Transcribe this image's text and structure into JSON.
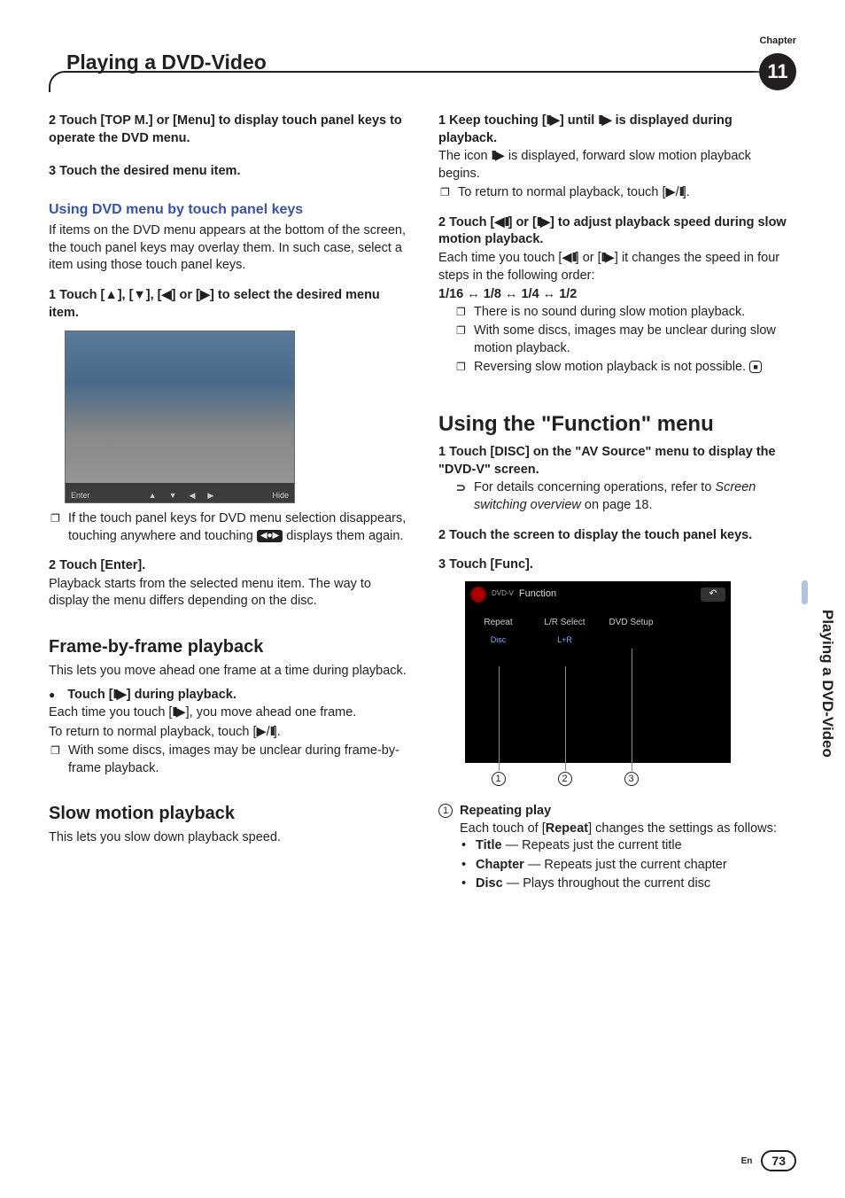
{
  "chapter_label": "Chapter",
  "chapter_number": "11",
  "page_title": "Playing a DVD-Video",
  "side_tab": "Playing a DVD-Video",
  "left": {
    "step2": "2    Touch [TOP M.] or [Menu] to display touch panel keys to operate the DVD menu.",
    "step3": "3    Touch the desired menu item.",
    "sub1_title": "Using DVD menu by touch panel keys",
    "sub1_body": "If items on the DVD menu appears at the bottom of the screen, the touch panel keys may overlay them. In such case, select a item using those touch panel keys.",
    "sub1_step1": "1    Touch [▲], [▼], [◀] or [▶] to select the desired menu item.",
    "img_enter": "Enter",
    "img_hide": "Hide",
    "sub1_note": "If the touch panel keys for DVD menu selection disappears, touching anywhere and touching ",
    "sub1_note_end": " displays them again.",
    "sub1_step2": "2    Touch [Enter].",
    "sub1_step2_body": "Playback starts from the selected menu item. The way to display the menu differs depending on the disc.",
    "sec2_title": "Frame-by-frame playback",
    "sec2_body": "This lets you move ahead one frame at a time during playback.",
    "sec2_bullet": "Touch [",
    "sec2_bullet_end": "] during playback.",
    "sec2_body2a": "Each time you touch [",
    "sec2_body2b": "], you move ahead one frame.",
    "sec2_body3": "To return to normal playback, touch [▶/",
    "sec2_body3_end": "].",
    "sec2_note": "With some discs, images may be unclear during frame-by-frame playback.",
    "sec3_title": "Slow motion playback",
    "sec3_body": "This lets you slow down playback speed."
  },
  "right": {
    "step1a": "1    Keep touching [",
    "step1b": "] until ",
    "step1c": " is displayed during playback.",
    "body1a": "The icon ",
    "body1b": " is displayed, forward slow motion playback begins.",
    "note1a": "To return to normal playback, touch [▶/",
    "note1b": "].",
    "step2a": "2    Touch [◀",
    "step2b": "] or [",
    "step2c": "▶] to adjust playback speed during slow motion playback.",
    "body2a": "Each time you touch [◀",
    "body2b": "] or [",
    "body2c": "▶] it changes the speed in four steps in the following order:",
    "speed": "1/16 ↔ 1/8 ↔ 1/4 ↔ 1/2",
    "note2_1": "There is no sound during slow motion playback.",
    "note2_2": "With some discs, images may be unclear during slow motion playback.",
    "note2_3a": "Reversing slow motion playback is not possible.",
    "sec_title": "Using the \"Function\" menu",
    "sec_step1": "1    Touch [DISC] on the \"AV Source\" menu to display the \"DVD-V\" screen.",
    "sec_note1": "For details concerning operations, refer to ",
    "sec_note1_ital": "Screen switching overview",
    "sec_note1_end": " on page 18.",
    "sec_step2": "2    Touch the screen to display the touch panel keys.",
    "sec_step3": "3    Touch [Func].",
    "func_label": "Function",
    "func_dvdv": "DVD-V",
    "func_repeat": "Repeat",
    "func_lr": "L/R Select",
    "func_dvd_setup": "DVD Setup",
    "func_disc": "Disc",
    "func_lr_val": "L+R",
    "item1_title": "Repeating play",
    "item1_body": "Each touch of [",
    "item1_body_bold": "Repeat",
    "item1_body_end": "] changes the settings as follows:",
    "bullet1_bold": "Title",
    "bullet1": " — Repeats just the current title",
    "bullet2_bold": "Chapter",
    "bullet2": " — Repeats just the current chapter",
    "bullet3_bold": "Disc",
    "bullet3": " — Plays throughout the current disc"
  },
  "footer": {
    "en": "En",
    "page": "73"
  }
}
